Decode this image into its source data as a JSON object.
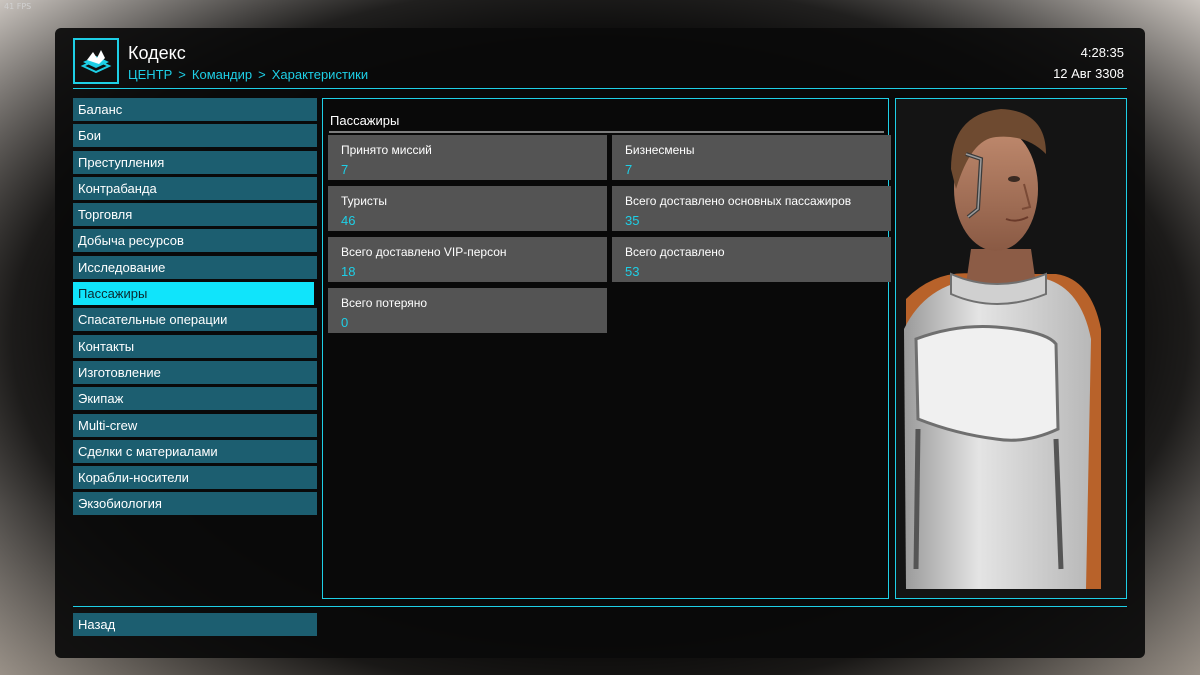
{
  "fps": "41 FPS",
  "header": {
    "title": "Кодекс",
    "breadcrumb": [
      "ЦЕНТР",
      ">",
      "Командир",
      ">",
      "Характеристики"
    ],
    "time": "4:28:35",
    "date": "12 Авг 3308"
  },
  "sidebar": {
    "items": [
      {
        "label": "Баланс"
      },
      {
        "label": "Бои"
      },
      {
        "label": "Преступления"
      },
      {
        "label": "Контрабанда"
      },
      {
        "label": "Торговля"
      },
      {
        "label": "Добыча ресурсов"
      },
      {
        "label": "Исследование"
      },
      {
        "label": "Пассажиры"
      },
      {
        "label": "Спасательные операции"
      },
      {
        "label": "Контакты"
      },
      {
        "label": "Изготовление"
      },
      {
        "label": "Экипаж"
      },
      {
        "label": "Multi-crew"
      },
      {
        "label": "Сделки с материалами"
      },
      {
        "label": "Корабли-носители"
      },
      {
        "label": "Экзобиология"
      }
    ],
    "active_index": 7
  },
  "footer": {
    "back_label": "Назад"
  },
  "section": {
    "title": "Пассажиры",
    "stats": [
      {
        "label": "Принято миссий",
        "value": "7"
      },
      {
        "label": "Бизнесмены",
        "value": "7"
      },
      {
        "label": "Туристы",
        "value": "46"
      },
      {
        "label": "Всего доставлено основных пассажиров",
        "value": "35"
      },
      {
        "label": "Всего доставлено VIP-персон",
        "value": "18"
      },
      {
        "label": "Всего доставлено",
        "value": "53"
      },
      {
        "label": "Всего потеряно",
        "value": "0"
      }
    ]
  },
  "colors": {
    "accent": "#1ecfe6",
    "active_item": "#10e4fb",
    "menu_item": "#1c5e70",
    "stat_card": "#545454"
  },
  "icons": {
    "logo": "codex-book-icon"
  }
}
